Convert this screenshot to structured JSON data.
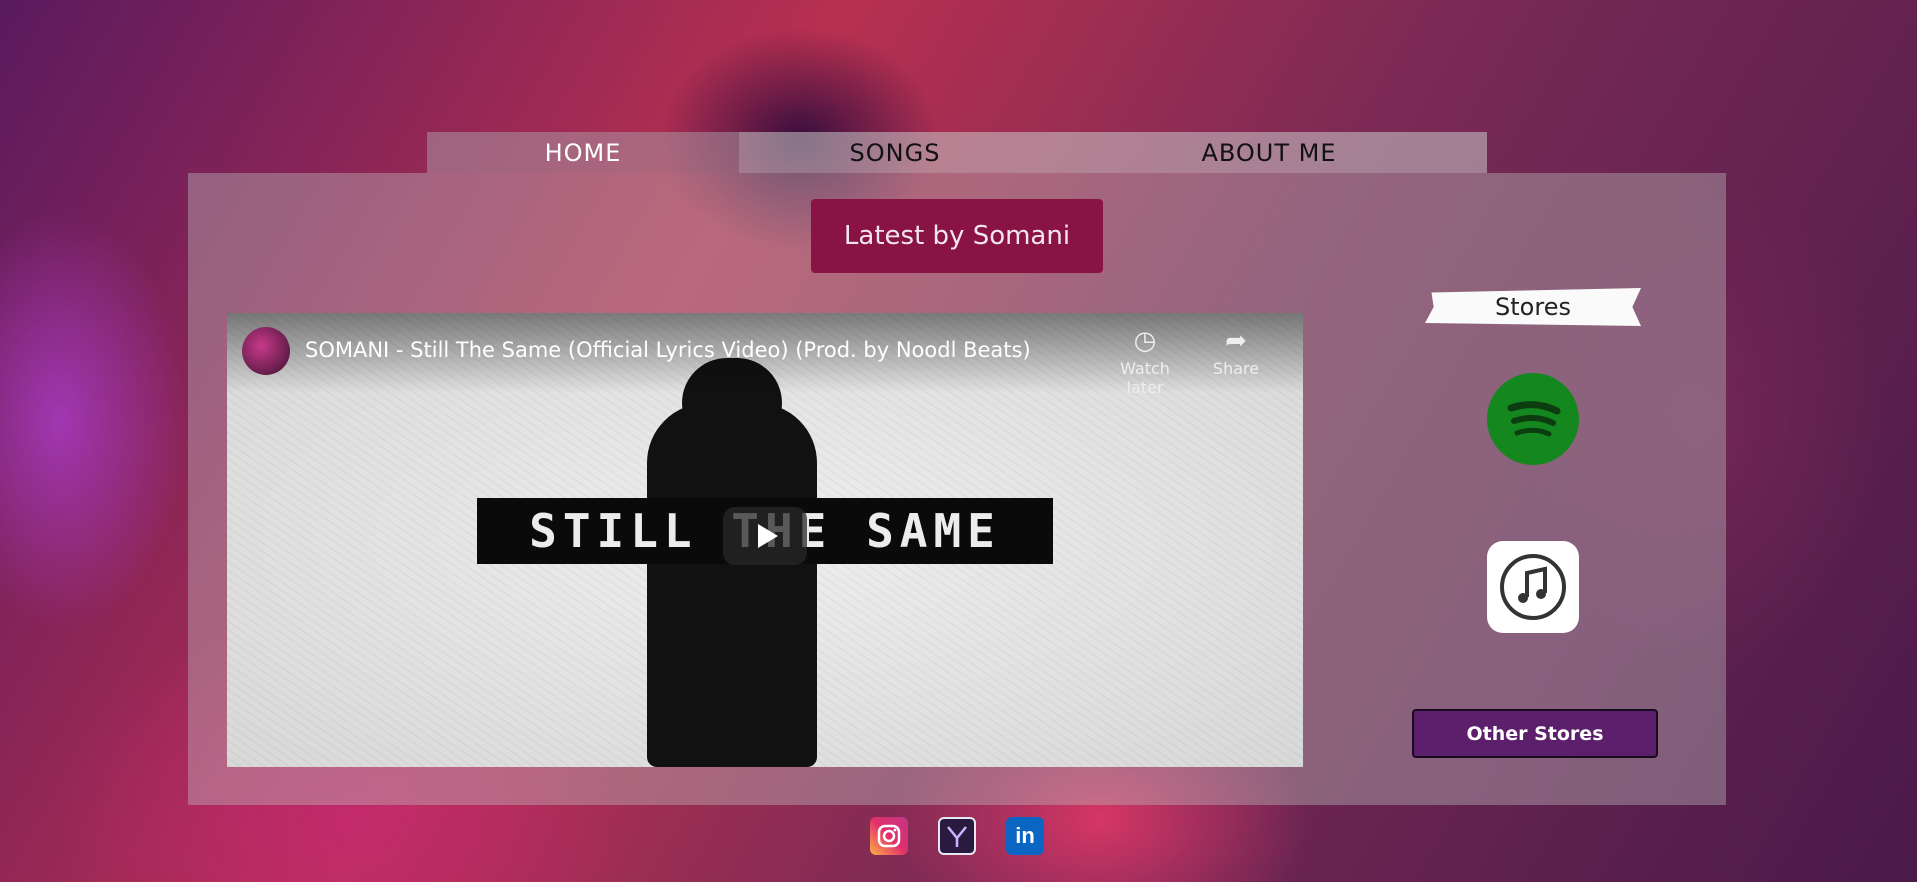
{
  "nav": {
    "items": [
      {
        "label": "HOME"
      },
      {
        "label": "SONGS"
      },
      {
        "label": "ABOUT ME"
      }
    ]
  },
  "main": {
    "latest_heading": "Latest by Somani",
    "video": {
      "title": "SOMANI - Still The Same (Official Lyrics Video) (Prod. by Noodl Beats)",
      "watch_later": "Watch later",
      "share": "Share",
      "thumbnail_text": "STILL THE SAME"
    }
  },
  "stores": {
    "label": "Stores",
    "items": [
      {
        "name": "spotify",
        "icon": "spotify-icon",
        "color": "#14871f"
      },
      {
        "name": "itunes",
        "icon": "itunes-icon",
        "color": "#ffffff"
      }
    ],
    "other_button": "Other Stores"
  },
  "socials": [
    {
      "icon": "instagram-icon"
    },
    {
      "icon": "y-media-icon"
    },
    {
      "icon": "linkedin-icon",
      "glyph": "in"
    }
  ],
  "colors": {
    "accent": "#8a1346",
    "button": "#5c1f6b",
    "spotify": "#14871f"
  }
}
